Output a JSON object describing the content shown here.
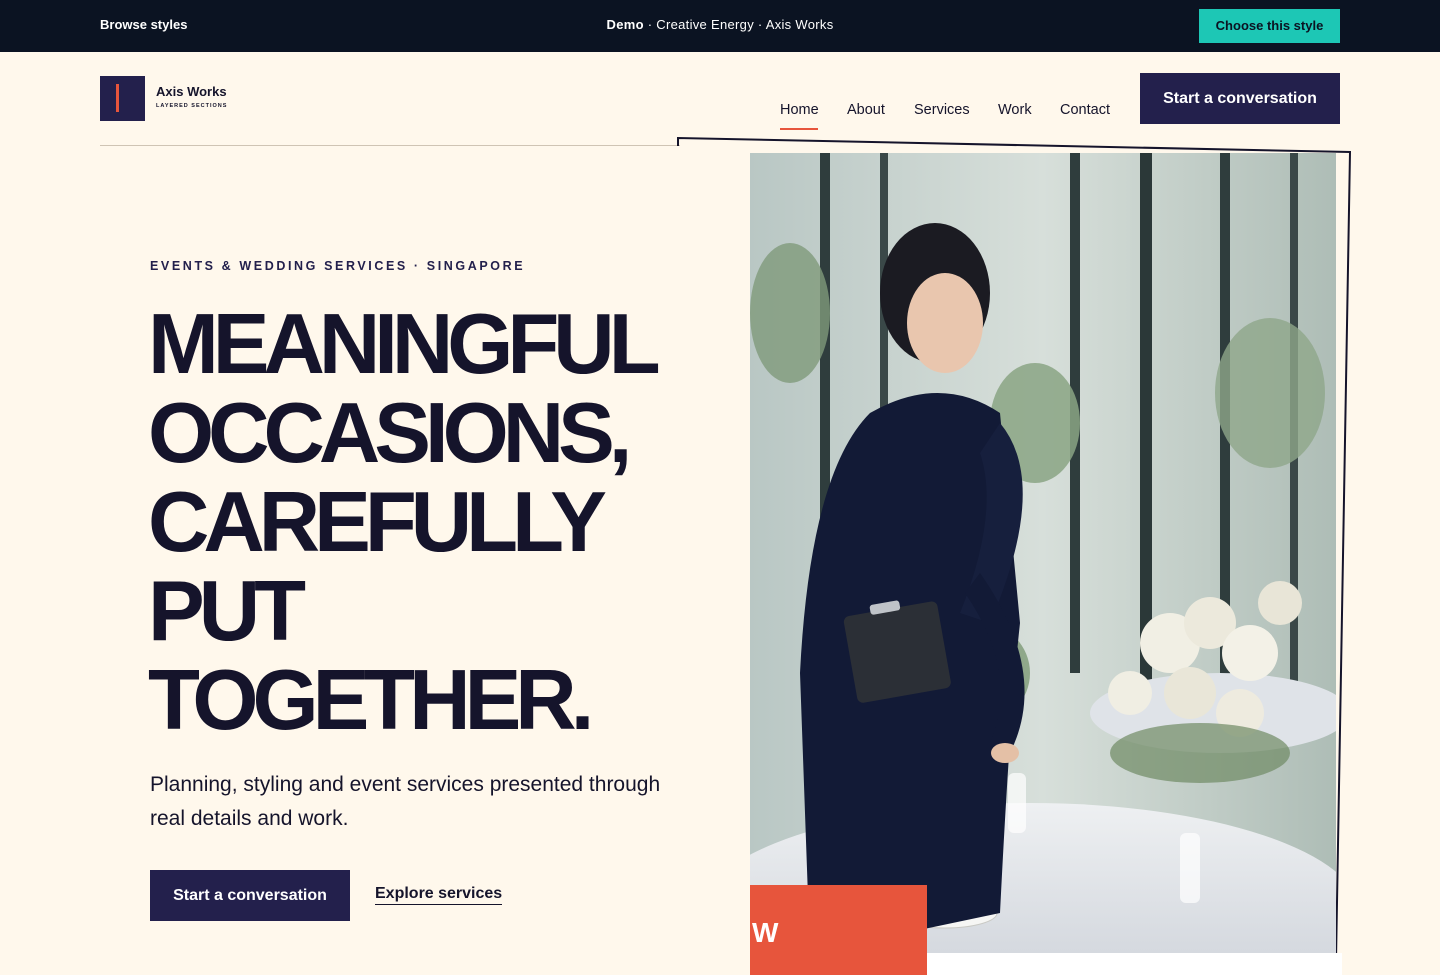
{
  "demo_bar": {
    "browse_label": "Browse styles",
    "center_prefix": "Demo",
    "center_rest": " · Creative Energy · Axis Works",
    "choose_label": "Choose this style"
  },
  "brand": {
    "name": "Axis Works",
    "tagline": "LAYERED SECTIONS"
  },
  "nav": {
    "items": [
      "Home",
      "About",
      "Services",
      "Work",
      "Contact"
    ],
    "active": "Home",
    "cta_label": "Start a conversation"
  },
  "hero": {
    "eyebrow": "EVENTS & WEDDING SERVICES · SINGAPORE",
    "headline_lines": [
      "MEANINGFUL",
      "OCCASIONS,",
      "CAREFULLY",
      "PUT",
      "TOGETHER."
    ],
    "subtext": "Planning, styling and event services presented through real details and work.",
    "primary_cta": "Start a conversation",
    "secondary_cta": "Explore services",
    "image_icon": "event-planner-photo",
    "tab_letter": "W"
  },
  "colors": {
    "navy": "#23204c",
    "accent": "#e7553c",
    "teal": "#1dc7b5",
    "cream": "#fff8ec",
    "topbar": "#0b1322"
  }
}
